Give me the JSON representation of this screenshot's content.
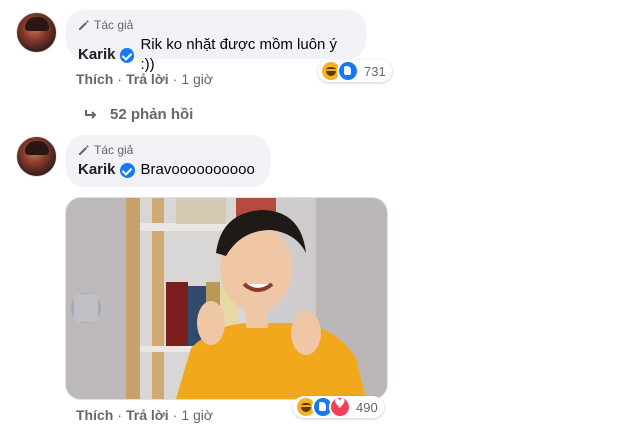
{
  "comments": [
    {
      "author_tag": "Tác giả",
      "author": "Karik",
      "text": "Rik ko nhặt được mồm luôn ý :))",
      "actions": {
        "like": "Thích",
        "reply": "Trả lời",
        "time": "1 giờ"
      },
      "reactions": {
        "icons": [
          "haha-icon",
          "like-icon"
        ],
        "count": "731"
      }
    },
    {
      "author_tag": "Tác giả",
      "author": "Karik",
      "text": "Bravoooooooooo",
      "actions": {
        "like": "Thích",
        "reply": "Trả lời",
        "time": "1 giờ"
      },
      "reactions": {
        "icons": [
          "haha-icon",
          "like-icon",
          "love-icon"
        ],
        "count": "490"
      }
    }
  ],
  "replies": {
    "label": "52 phản hồi"
  },
  "colors": {
    "bubble": "#f0f2f5",
    "verified": "#1877f2",
    "muted_text": "#65676b",
    "like": "#1877f2",
    "haha": "#f7b125",
    "love": "#f33e58"
  }
}
